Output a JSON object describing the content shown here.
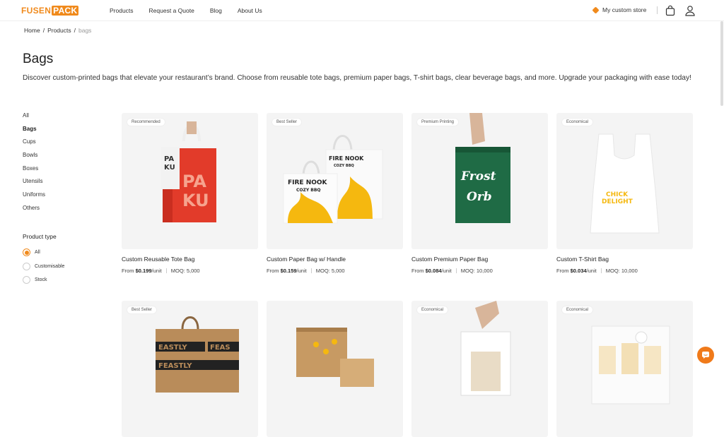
{
  "header": {
    "logo_part1": "FUSEN",
    "logo_part2": "PACK",
    "nav": [
      "Products",
      "Request a Quote",
      "Blog",
      "About Us"
    ],
    "store_label": "My custom store"
  },
  "breadcrumb": [
    "Home",
    "Products",
    "bags"
  ],
  "page": {
    "title": "Bags",
    "description": "Discover custom-printed bags that elevate your restaurant’s brand. Choose from reusable tote bags, premium paper bags, T-shirt bags, clear beverage bags, and more. Upgrade your packaging with ease today!"
  },
  "categories": [
    "All",
    "Bags",
    "Cups",
    "Bowls",
    "Boxes",
    "Utensils",
    "Uniforms",
    "Others"
  ],
  "active_category": "Bags",
  "product_type": {
    "heading": "Product type",
    "options": [
      "All",
      "Customisable",
      "Stock"
    ],
    "selected": "All"
  },
  "products": [
    {
      "badge": "Recommended",
      "name": "Custom Reusable Tote Bag",
      "price_prefix": "From ",
      "price": "$0.199",
      "unit": "/unit",
      "moq": "MOQ: 5,000"
    },
    {
      "badge": "Best Seller",
      "name": "Custom Paper Bag w/ Handle",
      "price_prefix": "From ",
      "price": "$0.159",
      "unit": "/unit",
      "moq": "MOQ: 5,000"
    },
    {
      "badge": "Premium Printing",
      "name": "Custom Premium Paper Bag",
      "price_prefix": "From ",
      "price": "$0.084",
      "unit": "/unit",
      "moq": "MOQ: 10,000"
    },
    {
      "badge": "Economical",
      "name": "Custom T-Shirt Bag",
      "price_prefix": "From ",
      "price": "$0.034",
      "unit": "/unit",
      "moq": "MOQ: 10,000"
    },
    {
      "badge": "Best Seller"
    },
    {
      "badge": ""
    },
    {
      "badge": "Economical"
    },
    {
      "badge": "Economical"
    }
  ],
  "image_text": {
    "paku": "PAKU",
    "fire_nook": "FIRE NOOK",
    "cozy_bbq": "COZY BBQ",
    "frost_orb": "Frost Orb",
    "chick_delight": "CHICK DELIGHT",
    "feastly": "FEASTLY"
  },
  "colors": {
    "brand": "#f08a1c",
    "tote_red": "#e23b2a",
    "premium_green": "#1f6b45",
    "flame_yellow": "#f5b80f",
    "kraft": "#b98c5a"
  }
}
